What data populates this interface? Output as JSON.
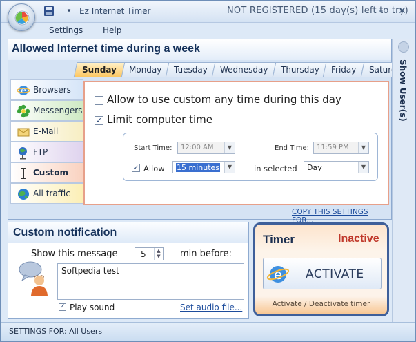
{
  "window": {
    "title": "Ez Internet Timer",
    "registration": "NOT REGISTERED (15 day(s) left to try)"
  },
  "menu": {
    "settings": "Settings",
    "help": "Help"
  },
  "main": {
    "heading": "Allowed Internet time during a week",
    "tabs": [
      {
        "label": "Sunday",
        "active": true
      },
      {
        "label": "Monday"
      },
      {
        "label": "Tuesday"
      },
      {
        "label": "Wednesday"
      },
      {
        "label": "Thursday"
      },
      {
        "label": "Friday"
      },
      {
        "label": "Saturday"
      }
    ],
    "side_items": [
      {
        "label": "Browsers",
        "icon": "ie-browser-icon",
        "color": "#dce8f8"
      },
      {
        "label": "Messengers",
        "icon": "messenger-flower-icon",
        "color": "#d9efd2"
      },
      {
        "label": "E-Mail",
        "icon": "email-envelope-icon",
        "color": "#f8f1cf"
      },
      {
        "label": "FTP",
        "icon": "ftp-globe-icon",
        "color": "#e8dff2"
      },
      {
        "label": "Custom",
        "icon": "custom-tool-icon",
        "color": "#fbe1d4",
        "active": true
      },
      {
        "label": "All traffic",
        "icon": "globe-icon",
        "color": "#fdf4c9"
      }
    ],
    "allow_custom_label": "Allow to use custom any time during this day",
    "limit_label": "Limit computer time",
    "limit_checked": true,
    "allow_custom_checked": false,
    "start_time_label": "Start Time:",
    "start_time": "12:00 AM",
    "end_time_label": "End Time:",
    "end_time": "11:59 PM",
    "allow_label": "Allow",
    "allow_checked": true,
    "allow_value": "15 minutes",
    "in_selected_label": "in selected",
    "period": "Day",
    "copy_link": "COPY THIS SETTINGS FOR..."
  },
  "notification": {
    "heading": "Custom notification",
    "show_message_label": "Show this message",
    "minutes": "5",
    "min_before_label": "min before:",
    "message_text": "Softpedia test",
    "play_sound_label": "Play sound",
    "play_sound_checked": true,
    "audio_link": "Set audio file..."
  },
  "timer": {
    "title": "Timer",
    "status": "Inactive",
    "activate_label": "ACTIVATE",
    "footer": "Activate / Deactivate timer"
  },
  "side_panel": {
    "label": "Show User(s)"
  },
  "statusbar": {
    "text": "SETTINGS FOR: All Users"
  },
  "colors": {
    "accent": "#15315a",
    "inactive": "#c0392b",
    "link": "#1d4c9c"
  }
}
